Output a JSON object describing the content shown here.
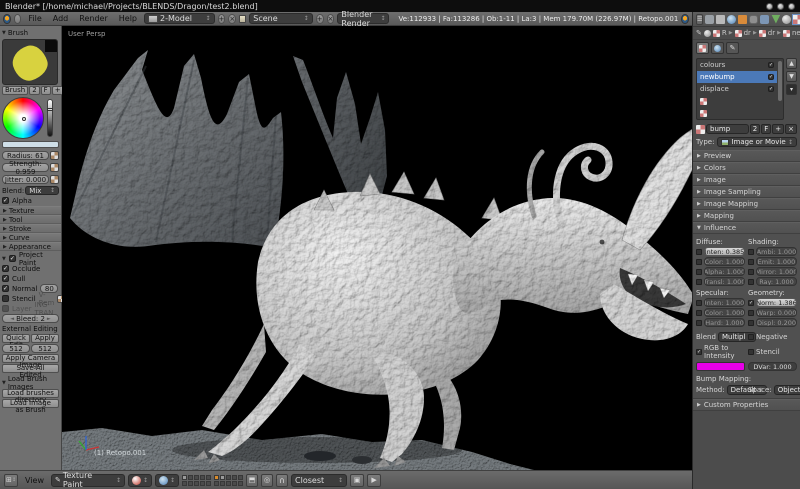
{
  "window": {
    "title": "Blender* [/home/michael/Projects/BLENDS/Dragon/test2.blend]"
  },
  "topbar": {
    "menus": [
      "File",
      "Add",
      "Render",
      "Help"
    ],
    "layout_name": "2-Model",
    "scene_name": "Scene",
    "engine": "Blender Render",
    "stats": "Ve:112933 | Fa:113286 | Ob:1-11 | La:3 | Mem 179.70M (226.97M) | Retopo.001"
  },
  "toolshelf": {
    "brush_header": "Brush",
    "brush_btn": "Brush",
    "brush_count": "2",
    "fake_user": "F",
    "radius": "Radius: 61",
    "strength": "Strength: 0.959",
    "jitter": "Jitter: 0.000",
    "blend_label": "Blend:",
    "blend_value": "Mix",
    "alpha": "Alpha",
    "collapsed": [
      "Texture",
      "Tool",
      "Stroke",
      "Curve",
      "Appearance"
    ],
    "project_paint": "Project Paint",
    "occlude": "Occlude",
    "cull": "Cull",
    "normal": "Normal",
    "normal_value": "80",
    "stencil": "Stencil",
    "stencil_extra": "V-Rem",
    "layer": "Layer",
    "layer_extra": "ING-TRAN",
    "bleed": "Bleed: 2",
    "external_editing": "External Editing",
    "quick_edit": "Quick Edit",
    "apply": "Apply",
    "res_x": "512",
    "res_y": "512",
    "apply_camera": "Apply Camera Image",
    "save_all": "Save All Edited",
    "load_header": "Load Brush Images",
    "load_dir": "Load brushes directory",
    "load_img": "Load Image as Brush"
  },
  "viewport": {
    "view_label": "User Persp",
    "object_label": "(1) Retopo.001"
  },
  "vheader": {
    "view_menu": "View",
    "mode": "Texture Paint",
    "snap_target": "Closest"
  },
  "props": {
    "breadcrumb": [
      "R",
      "dr",
      "dr",
      "ne"
    ],
    "slots": [
      {
        "name": "colours"
      },
      {
        "name": "newbump"
      },
      {
        "name": "displace"
      }
    ],
    "tex_name": "bump",
    "tex_users": "2",
    "fake_user": "F",
    "type_label": "Type:",
    "type_value": "Image or Movie",
    "panels": [
      "Preview",
      "Colors",
      "Image",
      "Image Sampling",
      "Image Mapping",
      "Mapping"
    ],
    "influence": {
      "header": "Influence",
      "diffuse_label": "Diffuse:",
      "shading_label": "Shading:",
      "diffuse": [
        "Inten: 0.385",
        "Color: 1.000",
        "Alpha: 1.000",
        "Transl: 1.000"
      ],
      "shading": [
        "Ambi: 1.000",
        "Emit: 1.000",
        "Mirror: 1.000",
        "Ray: 1.000"
      ],
      "specular_label": "Specular:",
      "geometry_label": "Geometry:",
      "specular": [
        "Inten: 1.000",
        "Color: 1.000",
        "Hard: 1.000"
      ],
      "geometry": [
        "Norm: 1.386",
        "Warp: 0.000",
        "Displ: 0.200"
      ],
      "blend_label": "Blend",
      "blend_value": "Multipl",
      "negative": "Negative",
      "rgb_to_intensity": "RGB to Intensity",
      "stencil": "Stencil",
      "swatch_color": "#e800e8",
      "dvar": "DVar: 1.000",
      "bump_label": "Bump Mapping:",
      "method_label": "Method:",
      "method_value": "Default",
      "space_label": "Space:",
      "space_value": "Object"
    },
    "custom_props": "Custom Properties"
  },
  "colors": {
    "selection_blue": "#4b79b8",
    "magenta_swatch": "#e800e8",
    "brush_yellow": "#d8d23f",
    "layer_active_orange": "#d98b2b"
  }
}
